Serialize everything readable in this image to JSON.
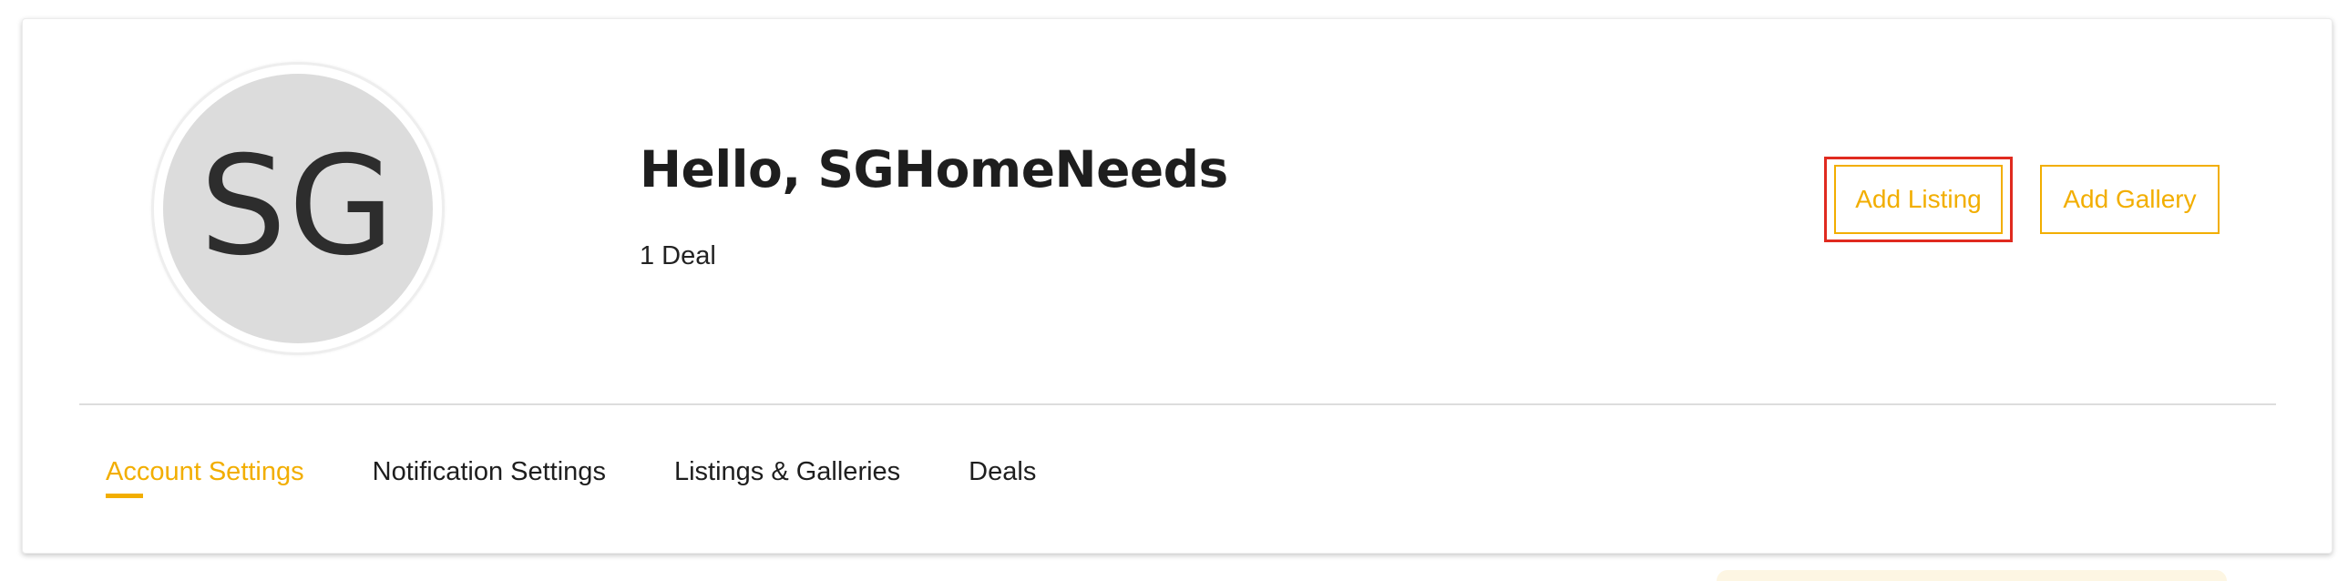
{
  "profile": {
    "avatar_initials": "SG",
    "greeting": "Hello, SGHomeNeeds",
    "deal_count_text": "1 Deal"
  },
  "actions": {
    "add_listing_label": "Add Listing",
    "add_gallery_label": "Add Gallery"
  },
  "tabs": [
    {
      "label": "Account Settings",
      "active": true
    },
    {
      "label": "Notification Settings",
      "active": false
    },
    {
      "label": "Listings & Galleries",
      "active": false
    },
    {
      "label": "Deals",
      "active": false
    }
  ],
  "colors": {
    "accent": "#f2ae00",
    "focus_outline": "#e02a1f",
    "avatar_bg": "#dcdcdc",
    "text": "#1e1e1e",
    "divider": "#dddddd"
  }
}
